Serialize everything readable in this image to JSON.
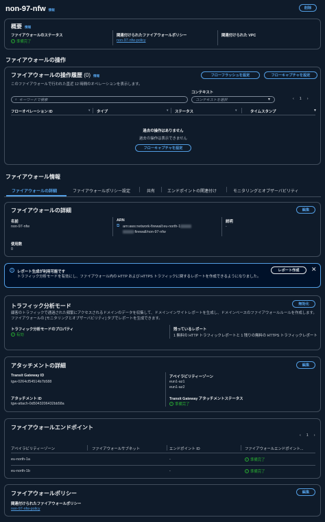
{
  "page": {
    "title": "non-97-nfw",
    "info": "情報",
    "delete_button": "削除"
  },
  "overview": {
    "title": "概要",
    "info": "情報",
    "status_label": "ファイアウォールのステータス",
    "status_value": "準備完了",
    "policy_label": "関連付けられたファイアウォールポリシー",
    "policy_value": "non-97-nfw-policy",
    "vpc_label": "関連付けられた VPC"
  },
  "operations": {
    "section_title": "ファイアウォールの操作"
  },
  "history": {
    "title": "ファイアウォールの操作履歴",
    "count": "(0)",
    "info": "情報",
    "desc": "このファイアウォールで行われた直近 12 時間のオペレーションを表示します。",
    "flow_flush_button": "フローフラッシュを設定",
    "flow_capture_button": "フローキャプチャを設定",
    "search_placeholder": "キーワードで検索",
    "context_label": "コンテキスト",
    "context_placeholder": "コンテキストを選択",
    "page_number": "1",
    "columns": [
      "フローオペレーション ID",
      "タイプ",
      "ステータス",
      "タイムスタンプ"
    ],
    "empty_title": "過去の操作はありません",
    "empty_desc": "過去の操作は表示できません",
    "empty_button": "フローキャプチャを設定"
  },
  "info_section": {
    "title": "ファイアウォール情報"
  },
  "tabs": [
    "ファイアウォールの詳細",
    "ファイアウォールポリシー設定",
    "共有",
    "エンドポイントの関連付け",
    "モニタリングとオブザーバビリティ"
  ],
  "details": {
    "title": "ファイアウォールの詳細",
    "edit_button": "編集",
    "name_label": "名前",
    "name_value": "non-97-nfw",
    "arn_label": "ARN",
    "arn_line1": "arn:aws:network-firewall:eu-north-1",
    "arn_line2": ":firewall/non-97-nfw",
    "desc_label": "説明",
    "desc_value": "-",
    "usage_label": "使用数",
    "usage_value": "0"
  },
  "alert": {
    "title": "レポート生成が利用可能です",
    "text": "トラフィック分析モードを有効にし、ファイアウォール内の HTTP および HTTPS トラフィックに関するレポートを作成できるようになりました。",
    "button": "レポート作成"
  },
  "traffic": {
    "title": "トラフィック分析モード",
    "disable_button": "無効化",
    "desc": "顧客のトラフィックで通過された頻繁にアクセスされるドメインのデータを収集して、ドメインインサイトレポートを生成し、ドメインベースのファイアウォールルールを作成します。ファイアウォールの [モニタリングとオブザーバビリティ] タブでレポートを生成できます。",
    "prop_label": "トラフィック分析モードのプロパティ",
    "prop_value": "有効",
    "remaining_label": "残っているレポート",
    "remaining_value": "1 無料の HTTP トラフィックレポートと 1 残りの無料の HTTPS トラフィックレポート"
  },
  "attachment": {
    "title": "アタッチメントの詳細",
    "edit_button": "編集",
    "tgw_label": "Transit Gateway ID",
    "tgw_value": "tgw-0264cf54514b7b588",
    "az_label": "アベイラビリティーゾーン",
    "az_values": [
      "eun1-az1",
      "eun1-az2"
    ],
    "att_label": "アタッチメント ID",
    "att_value": "tgw-attach-0d5043206432bb58a",
    "att_status_label": "Transit Gateway アタッチメントステータス",
    "att_status_value": "準備完了"
  },
  "endpoints": {
    "title": "ファイアウォールエンドポイント",
    "page_number": "1",
    "columns": [
      "アベイラビリティーゾーン",
      "ファイアウォールサブネット",
      "エンドポイント ID",
      "ファイアウォールエンドポイント..."
    ],
    "rows": [
      {
        "az": "eu-north-1a",
        "subnet": "",
        "endpoint": "-",
        "status": "準備完了"
      },
      {
        "az": "eu-north-1b",
        "subnet": "",
        "endpoint": "-",
        "status": "準備完了"
      }
    ]
  },
  "policy": {
    "title": "ファイアウォールポリシー",
    "edit_button": "編集",
    "label": "関連付けられたファイアウォールポリシー",
    "value": "non-97-nfw-policy"
  },
  "icons": {
    "check": "check-circle-icon",
    "info": "info-circle-icon",
    "close": "close-icon",
    "copy": "copy-icon",
    "search": "search-icon",
    "caret": "caret-down-icon"
  },
  "colors": {
    "background": "#0f1b2a",
    "accent": "#539fe5",
    "success": "#29ad32",
    "border": "#414d5c",
    "alert_bg": "#001129"
  }
}
